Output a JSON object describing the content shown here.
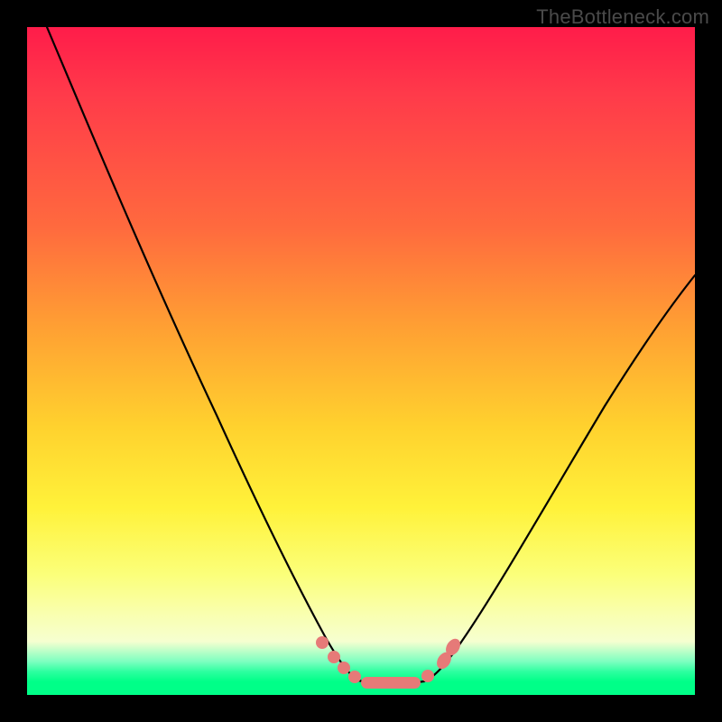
{
  "watermark": "TheBottleneck.com",
  "chart_data": {
    "type": "line",
    "title": "",
    "xlabel": "",
    "ylabel": "",
    "xlim": [
      0,
      100
    ],
    "ylim": [
      0,
      100
    ],
    "background_gradient": {
      "direction": "vertical",
      "stops": [
        {
          "pos": 0,
          "color": "#ff1c4a"
        },
        {
          "pos": 45,
          "color": "#ffa033"
        },
        {
          "pos": 72,
          "color": "#fff23a"
        },
        {
          "pos": 92,
          "color": "#f6ffd0"
        },
        {
          "pos": 98,
          "color": "#00ff88"
        }
      ]
    },
    "series": [
      {
        "name": "left-branch",
        "x": [
          3,
          10,
          20,
          30,
          38,
          43,
          47,
          49
        ],
        "values": [
          100,
          82,
          58,
          35,
          17,
          8,
          3,
          2
        ]
      },
      {
        "name": "right-branch",
        "x": [
          60,
          63,
          68,
          75,
          85,
          100
        ],
        "values": [
          2,
          3,
          8,
          20,
          40,
          63
        ]
      },
      {
        "name": "floor",
        "x": [
          49,
          55,
          60
        ],
        "values": [
          2,
          2,
          2
        ]
      }
    ],
    "markers": {
      "color": "#e67a78",
      "points": [
        {
          "x": 44,
          "y": 6.5
        },
        {
          "x": 46,
          "y": 4.5
        },
        {
          "x": 47.5,
          "y": 3.2
        },
        {
          "x": 49.5,
          "y": 2.3
        },
        {
          "x": 60,
          "y": 2.5
        },
        {
          "x": 62.5,
          "y": 5
        },
        {
          "x": 63.5,
          "y": 7
        }
      ],
      "pill": {
        "x0": 50,
        "x1": 59,
        "y": 2
      }
    }
  }
}
